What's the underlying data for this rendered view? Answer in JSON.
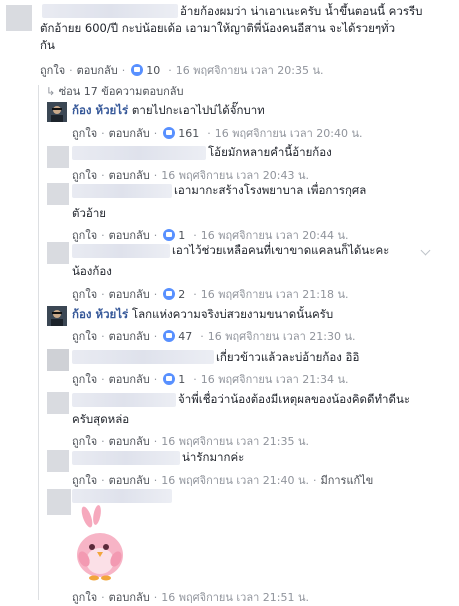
{
  "top_comment": {
    "line1": "อ้ายก้องผมว่า น่าเอาเนะครับ น้ำขึ้นตอนนี้ ควรรีบ",
    "line2": "ตักอ้ายย 600/ปี กะบ่น้อยเด้อ เอามาให้ญาติพี่น้องคนอีสาน จะได้รวยๆทั่ว",
    "line3": "กัน",
    "like": "ถูกใจ",
    "reply": "ตอบกลับ",
    "count": "10",
    "time": "16 พฤศจิกายน เวลา 20:35 น."
  },
  "replies_toggle": "ซ่อน 17 ข้อความตอบกลับ",
  "replies": [
    {
      "name": "ก้อง ห้วยไร่",
      "text": "ตายไปกะเอาไปบ่ได้จั๊กบาท",
      "like": "ถูกใจ",
      "reply": "ตอบกลับ",
      "count": "161",
      "time": "16 พฤศจิกายน เวลา 20:40 น."
    },
    {
      "text": "โอ้ยมักหลายคำนี้อ้ายก้อง",
      "like": "ถูกใจ",
      "reply": "ตอบกลับ",
      "time": "16 พฤศจิกายน เวลา 20:43 น."
    },
    {
      "line1": "เอามากะสร้างโรงพยาบาล เพื่อการกุศล",
      "line2": "ตัวอ้าย",
      "like": "ถูกใจ",
      "reply": "ตอบกลับ",
      "count": "1",
      "time": "16 พฤศจิกายน เวลา 20:44 น."
    },
    {
      "line1": "เอาไว้ช่วยเหลือคนที่เขาขาดแคลนก็ได้นะคะ",
      "line2": "น้องก้อง",
      "like": "ถูกใจ",
      "reply": "ตอบกลับ",
      "count": "2",
      "time": "16 พฤศจิกายน เวลา 21:18 น."
    },
    {
      "name": "ก้อง ห้วยไร่",
      "text": "โลกแห่งความจริงบ่สวยงามขนาดนั้นครับ",
      "like": "ถูกใจ",
      "reply": "ตอบกลับ",
      "count": "47",
      "time": "16 พฤศจิกายน เวลา 21:30 น."
    },
    {
      "text": "เกี่ยวข้าวแล้วละบ่อ้ายก้อง อิอิ",
      "like": "ถูกใจ",
      "reply": "ตอบกลับ",
      "count": "1",
      "time": "16 พฤศจิกายน เวลา 21:34 น."
    },
    {
      "line1": "จ้าพี่เชื่อว่าน้องต้องมีเหตุผลของน้องคิดดีทำดีนะ",
      "line2": "ครับสุดหล่อ",
      "like": "ถูกใจ",
      "reply": "ตอบกลับ",
      "time": "16 พฤศจิกายน เวลา 21:35 น."
    },
    {
      "text": "น่ารักมากค่ะ",
      "like": "ถูกใจ",
      "reply": "ตอบกลับ",
      "time": "16 พฤศจิกายน เวลา 21:40 น.",
      "edited": "มีการแก้ไข"
    },
    {
      "like": "ถูกใจ",
      "reply": "ตอบกลับ",
      "time": "16 พฤศจิกายน เวลา 21:51 น."
    }
  ]
}
